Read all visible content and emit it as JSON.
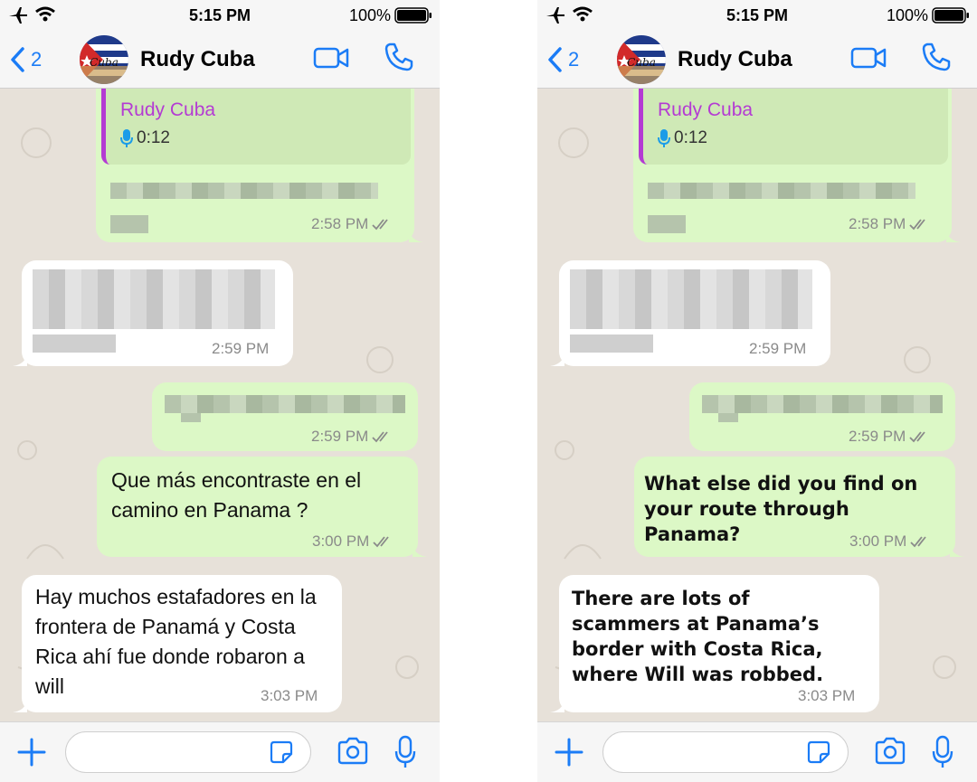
{
  "status_bar": {
    "time": "5:15 PM",
    "battery": "100%"
  },
  "header": {
    "back_count": "2",
    "contact_name": "Rudy Cuba",
    "avatar_text": "Cuba"
  },
  "messages": {
    "quoted": {
      "author": "Rudy Cuba",
      "duration": "0:12",
      "time": "2:58 PM"
    },
    "incoming_blurred": {
      "time": "2:59 PM"
    },
    "outgoing_blurred": {
      "time": "2:59 PM"
    },
    "question": {
      "text_original": "Que más encontraste en el camino en Panama ?",
      "text_translated": "What else did you find on your route through Panama?",
      "time": "3:00 PM"
    },
    "answer": {
      "text_original": "Hay muchos estafadores en la frontera de Panamá y Costa Rica ahí fue donde robaron a will",
      "text_translated": "There are lots of scammers at Panama’s border with Costa Rica, where Will was robbed.",
      "time": "3:03 PM"
    }
  },
  "icons": [
    "airplane-icon",
    "wifi-icon",
    "battery-icon",
    "back-chevron-icon",
    "video-call-icon",
    "phone-call-icon",
    "plus-icon",
    "sticker-icon",
    "camera-icon",
    "microphone-icon",
    "double-check-icon"
  ],
  "colors": {
    "outgoing_bubble": "#dcf8c6",
    "incoming_bubble": "#ffffff",
    "accent": "#1b7cf6",
    "quote_author": "#b43bd3",
    "wallpaper": "#e7e1d9"
  }
}
